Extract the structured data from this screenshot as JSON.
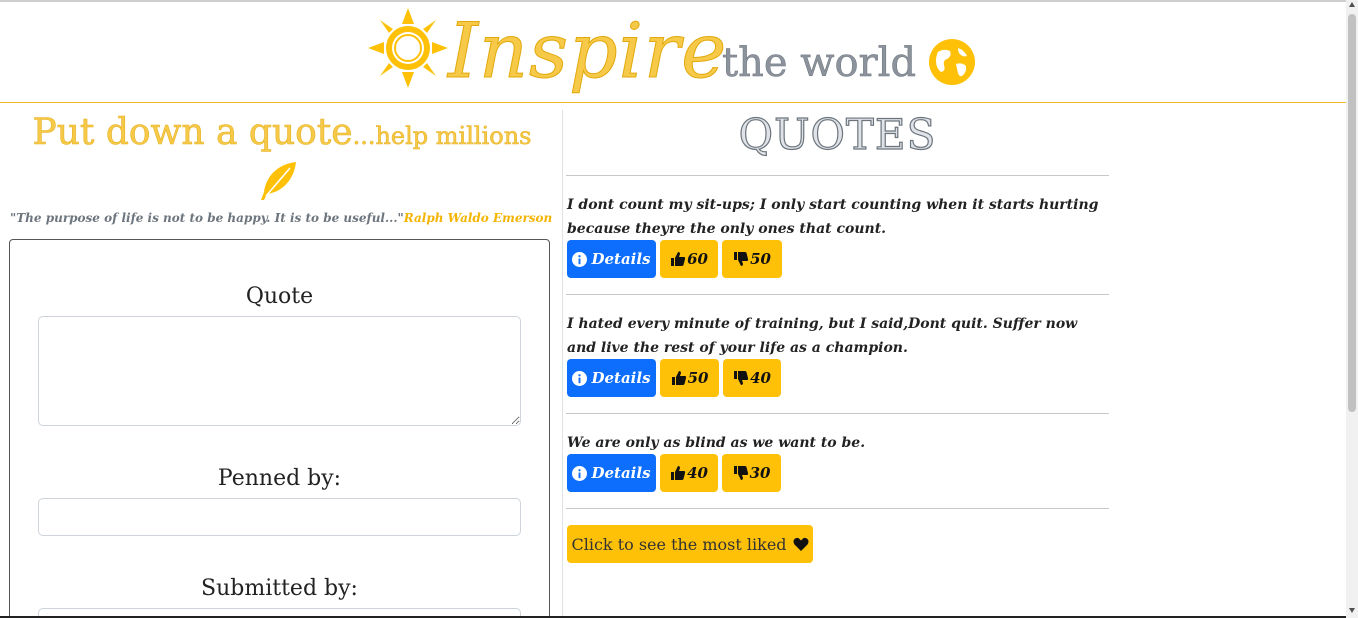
{
  "header": {
    "brand": "Inspire",
    "tagline": "the world"
  },
  "left": {
    "heading_big": "Put down a quote",
    "heading_small": "...help millions",
    "intro_quote": "\"The purpose of life is not to be happy. It is to be useful...\"",
    "intro_author": "Ralph Waldo Emerson",
    "form": {
      "quote_label": "Quote",
      "penned_label": "Penned by:",
      "submitted_label": "Submitted by:"
    }
  },
  "right": {
    "title": "QUOTES",
    "quotes": [
      {
        "text": "I dont count my sit-ups; I only start counting when it starts hurting because theyre the only ones that count.",
        "details": "Details",
        "likes": "60",
        "dislikes": "50"
      },
      {
        "text": "I hated every minute of training, but I said,Dont quit. Suffer now and live the rest of your life as a champion.",
        "details": "Details",
        "likes": "50",
        "dislikes": "40"
      },
      {
        "text": "We are only as blind as we want to be.",
        "details": "Details",
        "likes": "40",
        "dislikes": "30"
      }
    ],
    "most_liked_label": "Click to see the most liked"
  },
  "colors": {
    "accent": "#ffc107",
    "primary": "#0d6efd",
    "brand_yellow": "#f7c948",
    "muted": "#6c757d"
  },
  "icons": [
    "sun-icon",
    "globe-icon",
    "feather-icon",
    "info-icon",
    "thumbs-up-icon",
    "thumbs-down-icon",
    "heart-icon"
  ]
}
